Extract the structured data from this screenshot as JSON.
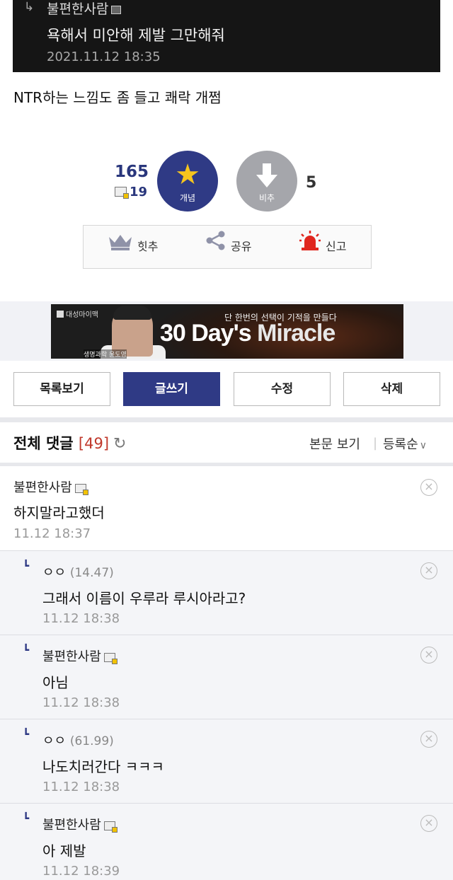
{
  "quote": {
    "arrow": "↳",
    "author": "불편한사람",
    "text": "욕해서 미안해 제발 그만해줘",
    "date": "2021.11.12 18:35"
  },
  "post": {
    "body": "NTR하는 느낌도 좀 들고 쾌락 개쩜"
  },
  "recommend": {
    "count": "165",
    "fixed_count": "19",
    "up_label": "개념",
    "down_label": "비추",
    "down_count": "5"
  },
  "actions": {
    "hit": "힛추",
    "share": "공유",
    "report": "신고"
  },
  "banner": {
    "brand": "대성마이맥",
    "subtitle": "단 한번의 선택이 기적을 만들다",
    "headline_a": "30 Day's ",
    "headline_b": "Miracle",
    "teacher": "생명과학 윤도영"
  },
  "buttons": {
    "list": "목록보기",
    "write": "글쓰기",
    "edit": "수정",
    "delete": "삭제"
  },
  "comments_header": {
    "title": "전체 댓글",
    "count": "[49]",
    "view_post": "본문 보기",
    "divider": "|",
    "order": "등록순"
  },
  "comments": [
    {
      "author": "불편한사람",
      "meta": "",
      "text": "하지말라고했더",
      "date": "11.12 18:37",
      "reply": false
    },
    {
      "author": "ㅇㅇ",
      "meta": "(14.47)",
      "text": "그래서 이름이 우루라 루시아라고?",
      "date": "11.12 18:38",
      "reply": true
    },
    {
      "author": "불편한사람",
      "meta": "",
      "text": "아님",
      "date": "11.12 18:38",
      "reply": true
    },
    {
      "author": "ㅇㅇ",
      "meta": "(61.99)",
      "text": "나도치러간다 ㅋㅋㅋ",
      "date": "11.12 18:38",
      "reply": true
    },
    {
      "author": "불편한사람",
      "meta": "",
      "text": "아 제발",
      "date": "11.12 18:39",
      "reply": true
    }
  ],
  "colors": {
    "accent": "#2f3a85",
    "star": "#f6c51e",
    "count_red": "#c0382b"
  },
  "icons": {
    "recommend": "star-icon",
    "nonrecommend": "down-arrow-icon",
    "hit": "crown-icon",
    "share": "share-icon",
    "report": "siren-icon",
    "refresh": "refresh-icon",
    "delete": "close-circle-icon"
  }
}
